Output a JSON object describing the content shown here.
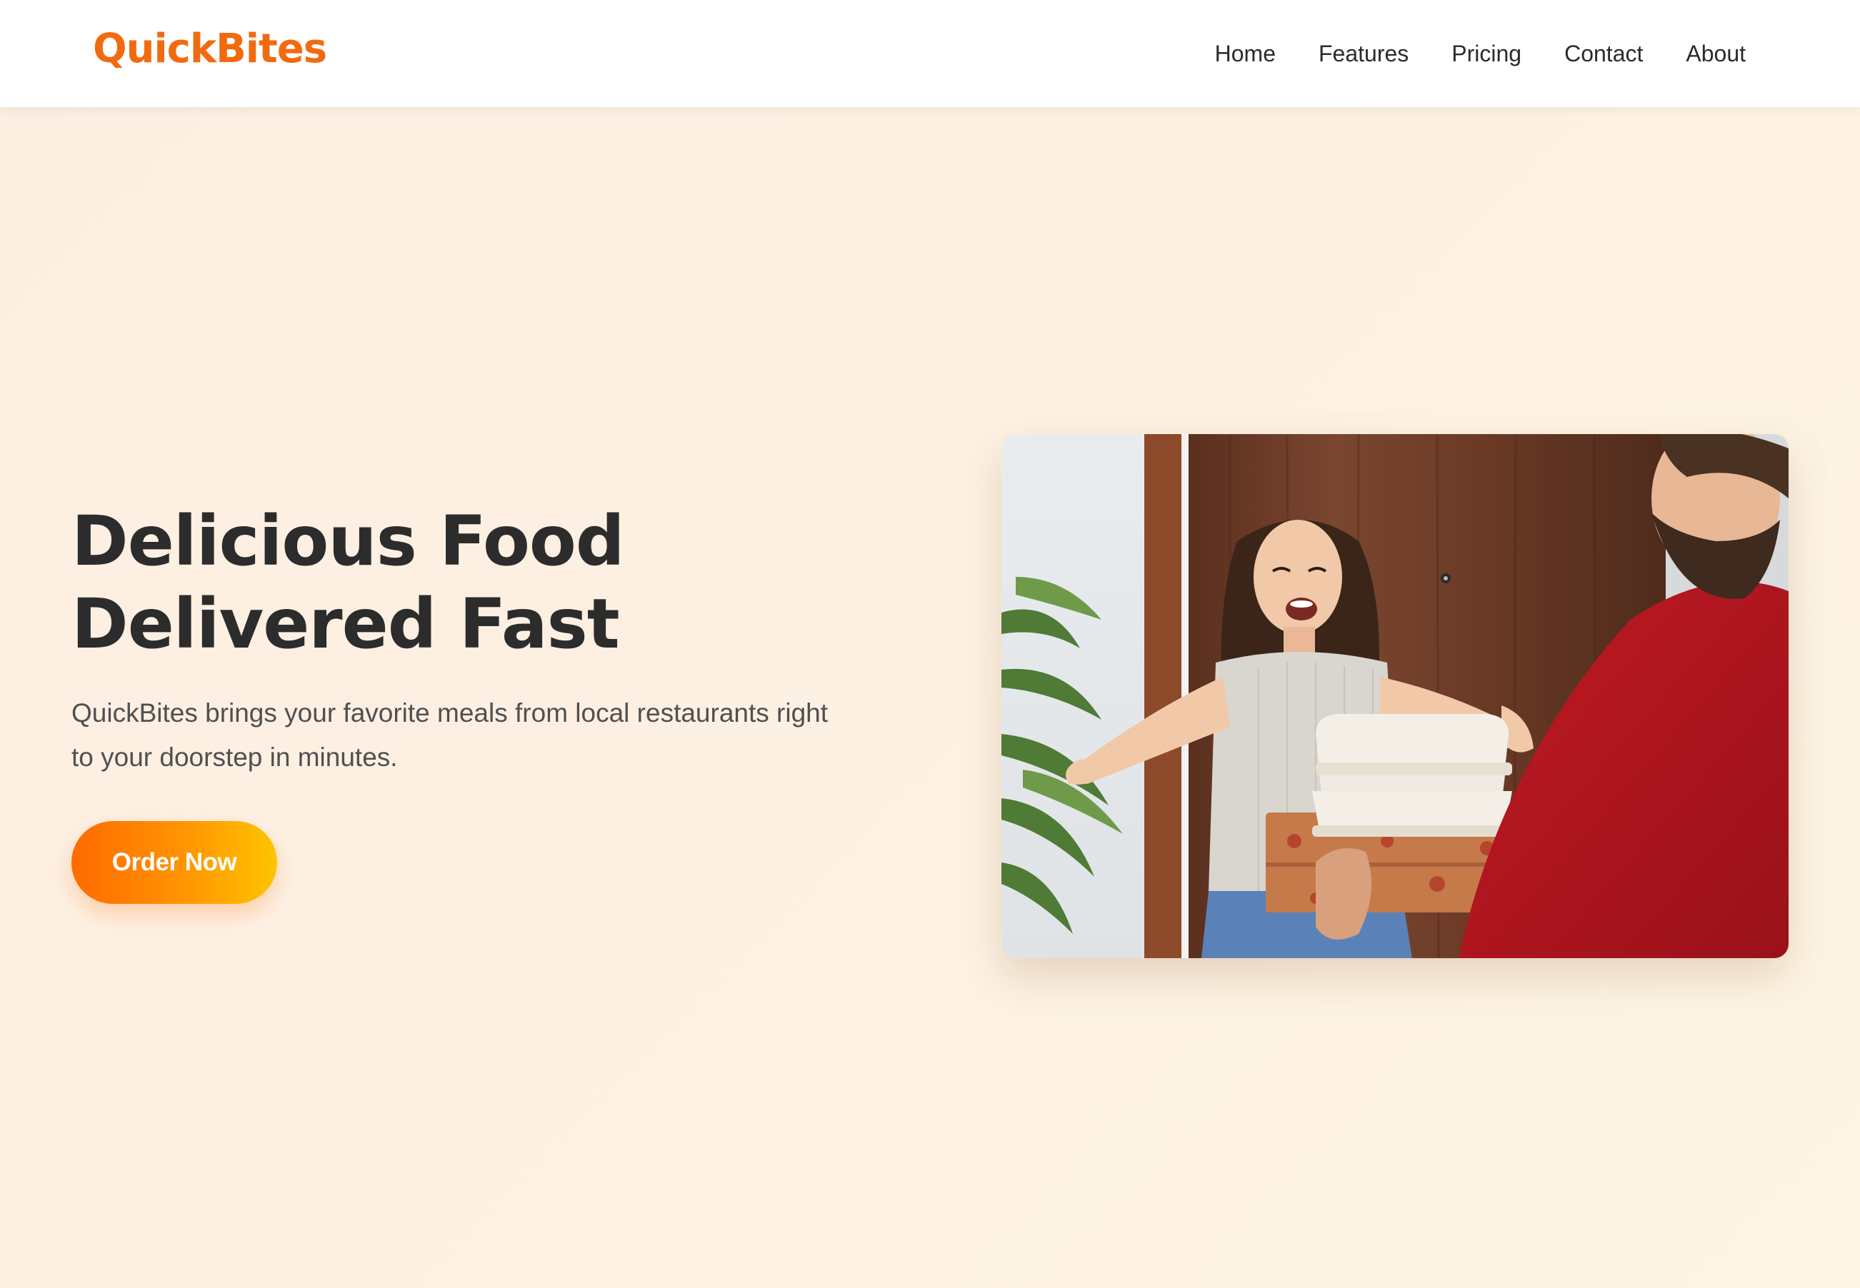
{
  "header": {
    "logo": "QuickBites",
    "nav": [
      {
        "label": "Home"
      },
      {
        "label": "Features"
      },
      {
        "label": "Pricing"
      },
      {
        "label": "Contact"
      },
      {
        "label": "About"
      }
    ]
  },
  "hero": {
    "title_line1": "Delicious Food",
    "title_line2": "Delivered Fast",
    "description": "QuickBites brings your favorite meals from local restaurants right to your doorstep in minutes.",
    "cta_label": "Order Now",
    "image_icon": "delivery-photo-icon"
  },
  "colors": {
    "brand": "#f26a10",
    "cta_start": "#ff6a00",
    "cta_end": "#ffc400",
    "heading": "#2c2c2c",
    "body_text": "#505050"
  }
}
